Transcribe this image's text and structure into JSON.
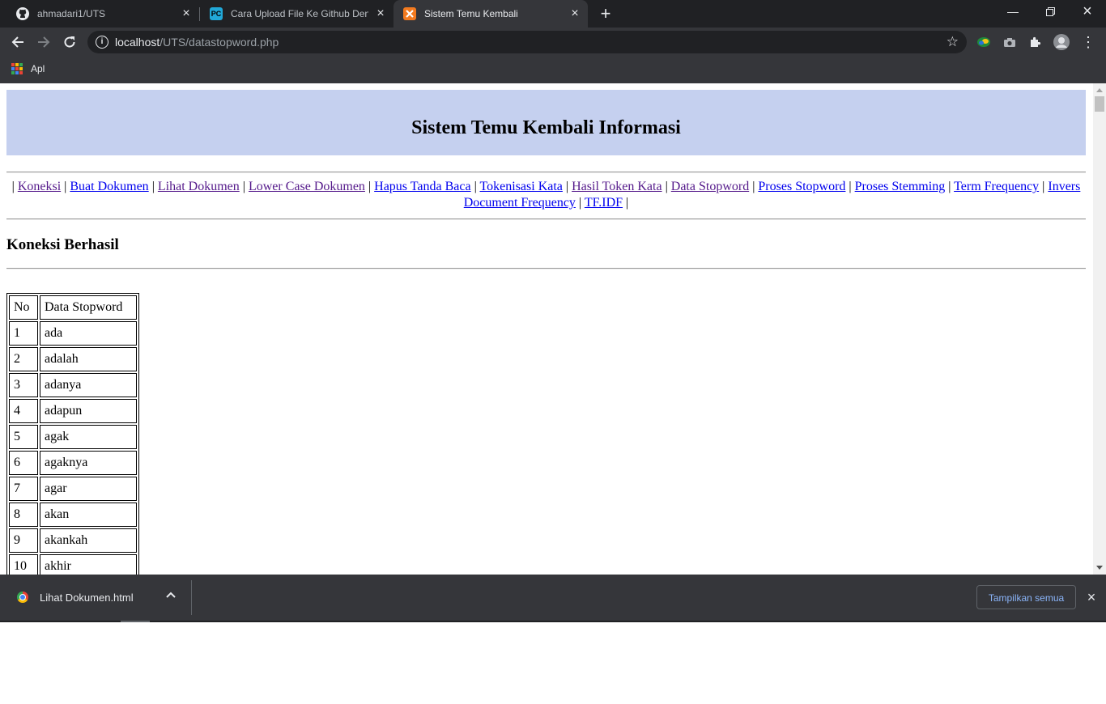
{
  "tabs": [
    {
      "title": "ahmadari1/UTS",
      "icon": "github-icon",
      "active": false
    },
    {
      "title": "Cara Upload File Ke Github Deng",
      "icon": "pycharm-icon",
      "active": false
    },
    {
      "title": "Sistem Temu Kembali",
      "icon": "xampp-icon",
      "active": true
    }
  ],
  "address": {
    "host": "localhost",
    "path": "/UTS/datastopword.php"
  },
  "bookmarks": {
    "apps_label": "Apl"
  },
  "page": {
    "title": "Sistem Temu Kembali Informasi",
    "nav": [
      {
        "label": "Koneksi",
        "visited": true
      },
      {
        "label": "Buat Dokumen",
        "visited": false
      },
      {
        "label": "Lihat Dokumen",
        "visited": true
      },
      {
        "label": "Lower Case Dokumen",
        "visited": true
      },
      {
        "label": "Hapus Tanda Baca",
        "visited": false
      },
      {
        "label": "Tokenisasi Kata",
        "visited": false
      },
      {
        "label": "Hasil Token Kata",
        "visited": true
      },
      {
        "label": "Data Stopword",
        "visited": true
      },
      {
        "label": "Proses Stopword",
        "visited": false
      },
      {
        "label": "Proses Stemming",
        "visited": false
      },
      {
        "label": "Term Frequency",
        "visited": false
      },
      {
        "label": "Invers Document Frequency",
        "visited": false
      },
      {
        "label": "TF.IDF",
        "visited": false
      }
    ],
    "nav_separator": "|",
    "status": "Koneksi Berhasil",
    "table": {
      "headers": [
        "No",
        "Data Stopword"
      ],
      "rows": [
        [
          "1",
          "ada"
        ],
        [
          "2",
          "adalah"
        ],
        [
          "3",
          "adanya"
        ],
        [
          "4",
          "adapun"
        ],
        [
          "5",
          "agak"
        ],
        [
          "6",
          "agaknya"
        ],
        [
          "7",
          "agar"
        ],
        [
          "8",
          "akan"
        ],
        [
          "9",
          "akankah"
        ],
        [
          "10",
          "akhir"
        ]
      ]
    }
  },
  "download_shelf": {
    "file_name": "Lihat Dokumen.html",
    "show_all_label": "Tampilkan semua"
  }
}
